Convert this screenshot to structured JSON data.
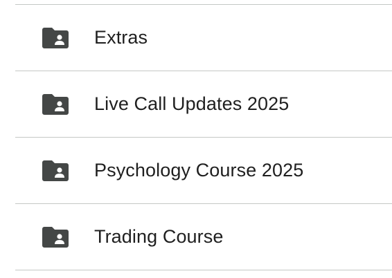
{
  "folders": [
    {
      "name": "Extras",
      "icon": "shared-folder-icon"
    },
    {
      "name": "Live Call Updates 2025",
      "icon": "shared-folder-icon"
    },
    {
      "name": "Psychology Course 2025",
      "icon": "shared-folder-icon"
    },
    {
      "name": "Trading Course",
      "icon": "shared-folder-icon"
    }
  ],
  "colors": {
    "icon": "#444746",
    "text": "#1f1f1f",
    "divider": "#c4c7c5"
  }
}
